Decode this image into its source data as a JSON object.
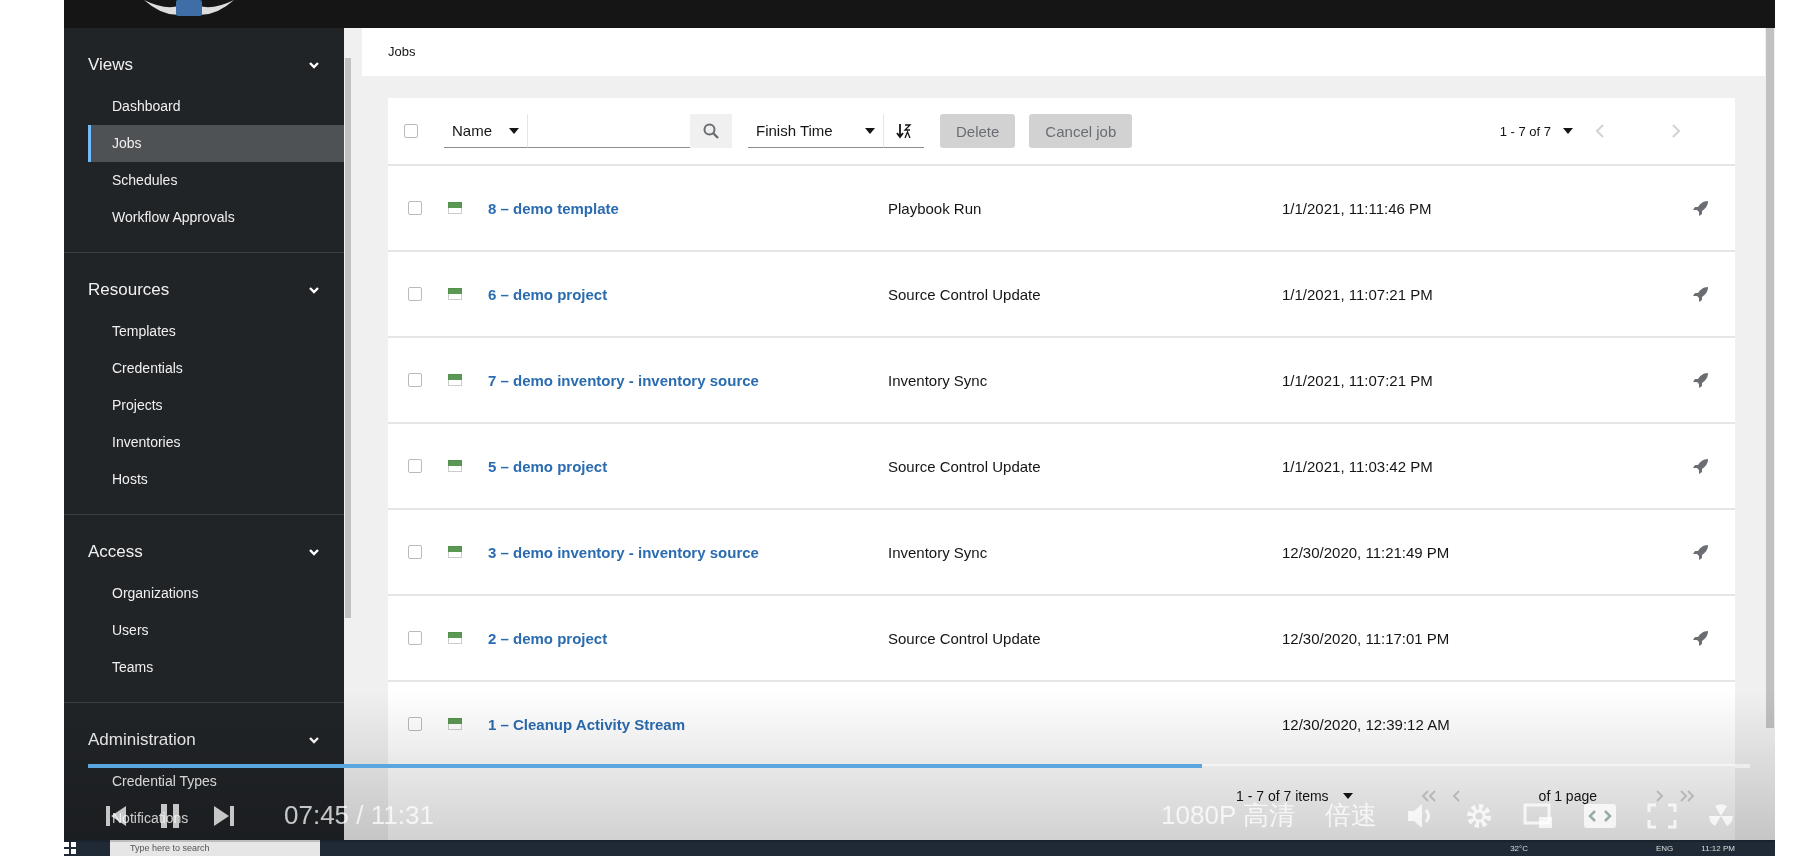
{
  "sidebar": {
    "groups": [
      {
        "title": "Views",
        "expanded": true,
        "items": [
          {
            "label": "Dashboard",
            "selected": false
          },
          {
            "label": "Jobs",
            "selected": true
          },
          {
            "label": "Schedules",
            "selected": false
          },
          {
            "label": "Workflow Approvals",
            "selected": false
          }
        ]
      },
      {
        "title": "Resources",
        "expanded": true,
        "items": [
          {
            "label": "Templates",
            "selected": false
          },
          {
            "label": "Credentials",
            "selected": false
          },
          {
            "label": "Projects",
            "selected": false
          },
          {
            "label": "Inventories",
            "selected": false
          },
          {
            "label": "Hosts",
            "selected": false
          }
        ]
      },
      {
        "title": "Access",
        "expanded": true,
        "items": [
          {
            "label": "Organizations",
            "selected": false
          },
          {
            "label": "Users",
            "selected": false
          },
          {
            "label": "Teams",
            "selected": false
          }
        ]
      },
      {
        "title": "Administration",
        "expanded": true,
        "items": [
          {
            "label": "Credential Types",
            "selected": false
          },
          {
            "label": "Notifications",
            "selected": false
          }
        ]
      }
    ]
  },
  "breadcrumb": "Jobs",
  "toolbar": {
    "select_all_checked": false,
    "search_field": "Name",
    "sort_field": "Finish Time",
    "buttons": [
      {
        "label": "Delete",
        "disabled": true
      },
      {
        "label": "Cancel job",
        "disabled": true
      }
    ],
    "pagination": "1 - 7 of 7"
  },
  "jobs": [
    {
      "checked": false,
      "name": "8 – demo template",
      "type": "Playbook Run",
      "finished": "1/1/2021, 11:11:46 PM",
      "relaunch": true
    },
    {
      "checked": false,
      "name": "6 – demo project",
      "type": "Source Control Update",
      "finished": "1/1/2021, 11:07:21 PM",
      "relaunch": true
    },
    {
      "checked": false,
      "name": "7 – demo inventory - inventory source",
      "type": "Inventory Sync",
      "finished": "1/1/2021, 11:07:21 PM",
      "relaunch": true
    },
    {
      "checked": false,
      "name": "5 – demo project",
      "type": "Source Control Update",
      "finished": "1/1/2021, 11:03:42 PM",
      "relaunch": true
    },
    {
      "checked": false,
      "name": "3 – demo inventory - inventory source",
      "type": "Inventory Sync",
      "finished": "12/30/2020, 11:21:49 PM",
      "relaunch": true
    },
    {
      "checked": false,
      "name": "2 – demo project",
      "type": "Source Control Update",
      "finished": "12/30/2020, 11:17:01 PM",
      "relaunch": true
    },
    {
      "checked": false,
      "name": "1 – Cleanup Activity Stream",
      "finished": "12/30/2020, 12:39:12 AM",
      "relaunch": false
    }
  ],
  "footer": {
    "items": "1 - 7 of 7 items",
    "pages": "of 1 page"
  },
  "player": {
    "level": 0.67,
    "time": "07:45 / 11:31",
    "quality": "1080P 高清",
    "speed": "倍速"
  },
  "taskbar": {
    "search_placeholder": "Type here to search",
    "weather": "32°C",
    "language": "ENG",
    "clock": "11:12 PM"
  }
}
